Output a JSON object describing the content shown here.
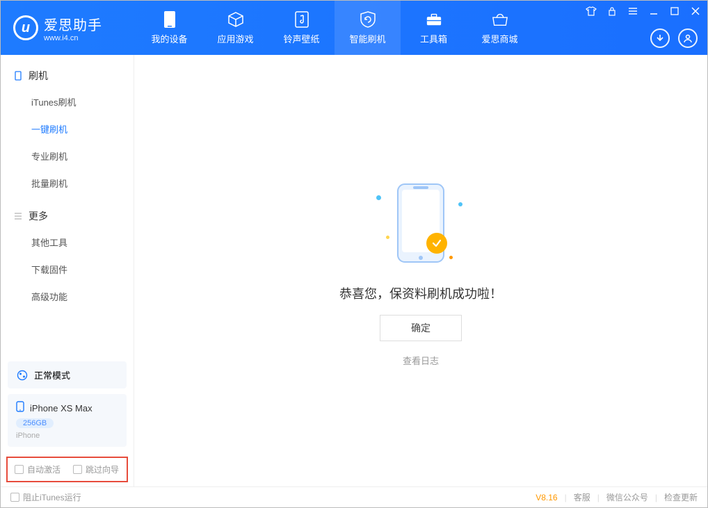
{
  "app": {
    "title": "爱思助手",
    "subtitle": "www.i4.cn"
  },
  "nav": {
    "items": [
      {
        "label": "我的设备"
      },
      {
        "label": "应用游戏"
      },
      {
        "label": "铃声壁纸"
      },
      {
        "label": "智能刷机",
        "active": true
      },
      {
        "label": "工具箱"
      },
      {
        "label": "爱思商城"
      }
    ]
  },
  "sidebar": {
    "section1_title": "刷机",
    "section1_items": [
      {
        "label": "iTunes刷机"
      },
      {
        "label": "一键刷机",
        "active": true
      },
      {
        "label": "专业刷机"
      },
      {
        "label": "批量刷机"
      }
    ],
    "section2_title": "更多",
    "section2_items": [
      {
        "label": "其他工具"
      },
      {
        "label": "下载固件"
      },
      {
        "label": "高级功能"
      }
    ],
    "mode_label": "正常模式",
    "device_name": "iPhone XS Max",
    "device_storage": "256GB",
    "device_type": "iPhone",
    "check_auto_activate": "自动激活",
    "check_skip_guide": "跳过向导"
  },
  "main": {
    "success_text": "恭喜您，保资料刷机成功啦！",
    "ok_button": "确定",
    "view_log": "查看日志"
  },
  "footer": {
    "block_itunes": "阻止iTunes运行",
    "version": "V8.16",
    "support": "客服",
    "wechat": "微信公众号",
    "check_update": "检查更新"
  }
}
